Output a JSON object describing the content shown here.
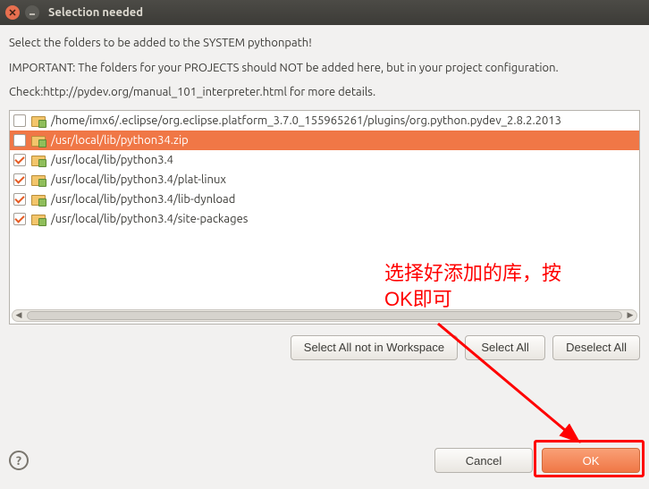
{
  "window": {
    "title": "Selection needed"
  },
  "intro": {
    "line1": "Select the folders to be added to the SYSTEM pythonpath!",
    "line2": "IMPORTANT: The folders for your PROJECTS should NOT be added here, but in your project configuration.",
    "line3": "Check:http://pydev.org/manual_101_interpreter.html for more details."
  },
  "items": [
    {
      "checked": false,
      "selected": false,
      "path": "/home/imx6/.eclipse/org.eclipse.platform_3.7.0_155965261/plugins/org.python.pydev_2.8.2.2013"
    },
    {
      "checked": false,
      "selected": true,
      "path": "/usr/local/lib/python34.zip"
    },
    {
      "checked": true,
      "selected": false,
      "path": "/usr/local/lib/python3.4"
    },
    {
      "checked": true,
      "selected": false,
      "path": "/usr/local/lib/python3.4/plat-linux"
    },
    {
      "checked": true,
      "selected": false,
      "path": "/usr/local/lib/python3.4/lib-dynload"
    },
    {
      "checked": true,
      "selected": false,
      "path": "/usr/local/lib/python3.4/site-packages"
    }
  ],
  "buttons": {
    "select_not_ws": "Select All not in Workspace",
    "select_all": "Select All",
    "deselect_all": "Deselect All",
    "cancel": "Cancel",
    "ok": "OK"
  },
  "annotation": {
    "line1": "选择好添加的库，按",
    "line2": "OK即可"
  }
}
